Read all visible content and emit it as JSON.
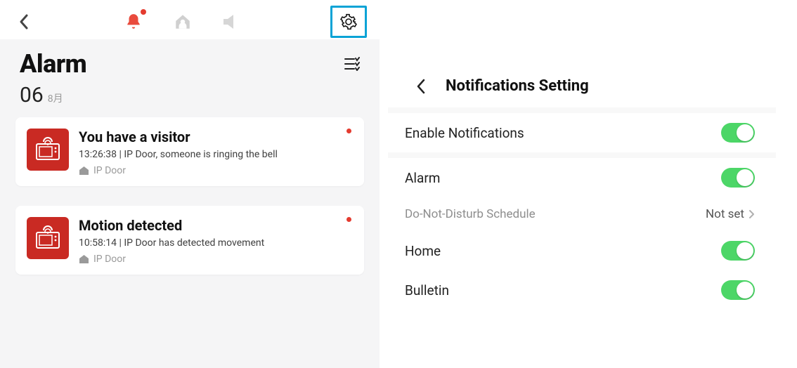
{
  "alarm": {
    "title": "Alarm",
    "date_day": "06",
    "date_month": "8月",
    "events": [
      {
        "title": "You have a visitor",
        "sub": "13:26:38 | IP Door, someone is ringing the bell",
        "source": "IP Door"
      },
      {
        "title": "Motion detected",
        "sub": "10:58:14 |  IP Door has detected movement",
        "source": "IP Door"
      }
    ]
  },
  "settings": {
    "title": "Notifications Setting",
    "enable_label": "Enable Notifications",
    "alarm_label": "Alarm",
    "dnd_label": "Do-Not-Disturb Schedule",
    "dnd_value": "Not set",
    "home_label": "Home",
    "bulletin_label": "Bulletin"
  }
}
